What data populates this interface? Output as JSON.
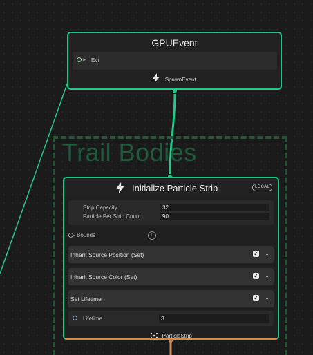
{
  "gpu_event_node": {
    "title": "GPUEvent",
    "input_port_label": "Evt",
    "output_label": "SpawnEvent"
  },
  "group": {
    "title": "Trail Bodies"
  },
  "init_node": {
    "title": "Initialize Particle Strip",
    "space_badge": "LOCAL",
    "settings": [
      {
        "label": "Strip Capacity",
        "value": "32"
      },
      {
        "label": "Particle Per Strip Count",
        "value": "90"
      }
    ],
    "bounds_label": "Bounds",
    "bounds_space_icon": "L",
    "blocks": [
      {
        "label": "Inherit Source Position (Set)",
        "enabled": true
      },
      {
        "label": "Inherit Source Color (Set)",
        "enabled": true
      },
      {
        "label": "Set Lifetime",
        "enabled": true
      }
    ],
    "lifetime": {
      "label": "Lifetime",
      "value": "3"
    },
    "output_label": "ParticleStrip"
  },
  "colors": {
    "node_border": "#1fc98a",
    "wire": "#1fc98a",
    "output_strip": "#d48a4a",
    "group_title": "#1e5a3c",
    "group_border": "#28543a"
  },
  "icons": {
    "spawn": "lightning-bolt-icon",
    "init": "lightning-bolt-icon",
    "strip": "particle-strip-icon",
    "checkbox": "check-icon",
    "chevron": "chevron-down-icon",
    "bounds_port": "port-circle-icon"
  }
}
